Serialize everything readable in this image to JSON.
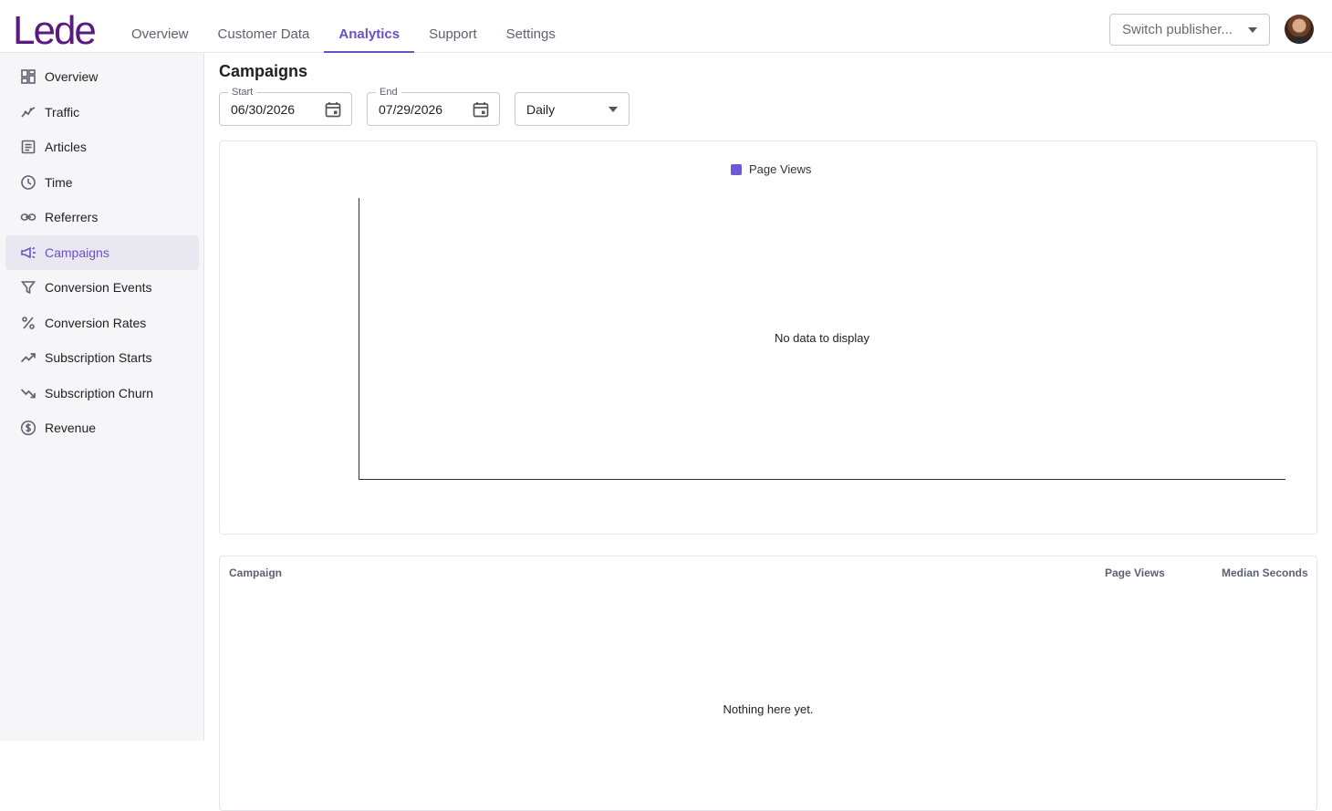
{
  "app": {
    "logo": "Lede"
  },
  "topnav": {
    "items": [
      {
        "label": "Overview"
      },
      {
        "label": "Customer Data"
      },
      {
        "label": "Analytics",
        "active": true
      },
      {
        "label": "Support"
      },
      {
        "label": "Settings"
      }
    ]
  },
  "publisher": {
    "placeholder": "Switch publisher..."
  },
  "sidebar": {
    "items": [
      {
        "label": "Overview",
        "icon": "dashboard-icon"
      },
      {
        "label": "Traffic",
        "icon": "traffic-chart-icon"
      },
      {
        "label": "Articles",
        "icon": "article-icon"
      },
      {
        "label": "Time",
        "icon": "clock-icon"
      },
      {
        "label": "Referrers",
        "icon": "link-icon"
      },
      {
        "label": "Campaigns",
        "icon": "megaphone-icon",
        "active": true
      },
      {
        "label": "Conversion Events",
        "icon": "funnel-icon"
      },
      {
        "label": "Conversion Rates",
        "icon": "percent-icon"
      },
      {
        "label": "Subscription Starts",
        "icon": "trending-up-icon"
      },
      {
        "label": "Subscription Churn",
        "icon": "trending-down-icon"
      },
      {
        "label": "Revenue",
        "icon": "dollar-icon"
      }
    ]
  },
  "page": {
    "title": "Campaigns"
  },
  "filters": {
    "start": {
      "label": "Start",
      "value": "06/30/2026"
    },
    "end": {
      "label": "End",
      "value": "07/29/2026"
    },
    "interval": {
      "value": "Daily"
    }
  },
  "chart_data": {
    "type": "line",
    "series": [
      {
        "name": "Page Views",
        "values": []
      }
    ],
    "categories": [],
    "legend": "top-center",
    "message": "No data to display",
    "color": "#6a5ad6"
  },
  "table": {
    "columns": [
      "Campaign",
      "Page Views",
      "Median Seconds"
    ],
    "rows": [],
    "empty_message": "Nothing here yet."
  },
  "colors": {
    "accent": "#6a4fc9",
    "logo": "#5a1a82"
  }
}
